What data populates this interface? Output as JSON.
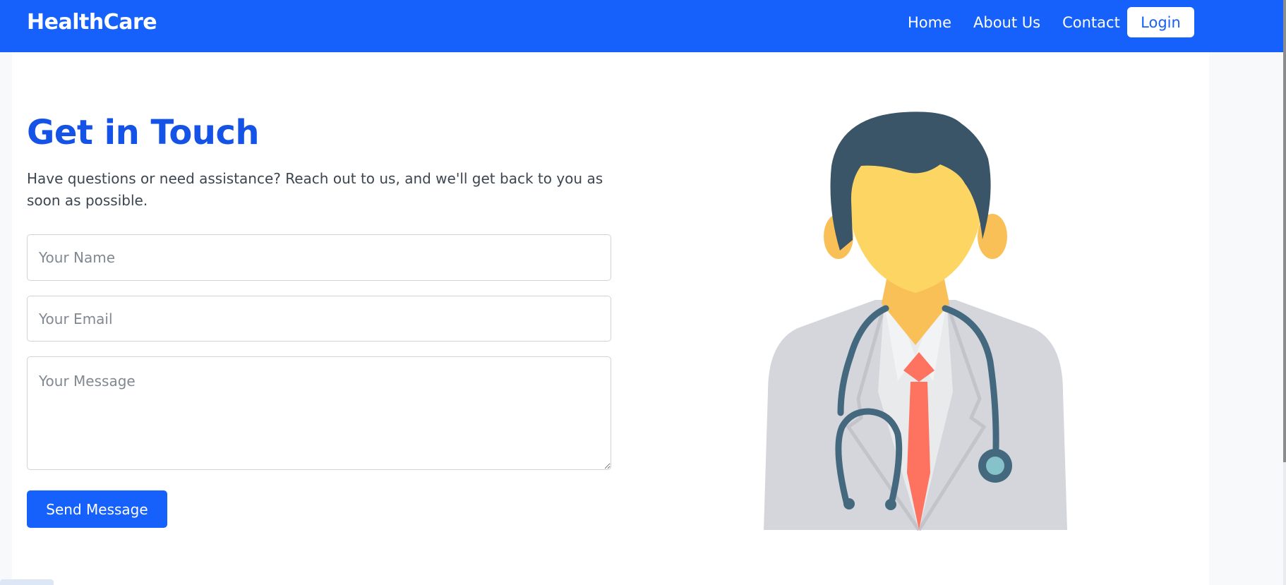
{
  "nav": {
    "brand": "HealthCare",
    "links": [
      "Home",
      "About Us",
      "Contact"
    ],
    "login_label": "Login"
  },
  "contact": {
    "title": "Get in Touch",
    "subtitle": "Have questions or need assistance? Reach out to us, and we'll get back to you as soon as possible.",
    "name_placeholder": "Your Name",
    "email_placeholder": "Your Email",
    "message_placeholder": "Your Message",
    "send_label": "Send Message"
  },
  "icons": {
    "illustration": "doctor-illustration"
  },
  "colors": {
    "brand_blue": "#1660fb",
    "title_blue": "#1453e6",
    "coat": "#d4d6dc",
    "hair": "#3a5468",
    "skin": "#fdd563",
    "tie": "#fe7360",
    "stethoscope": "#44697f"
  }
}
